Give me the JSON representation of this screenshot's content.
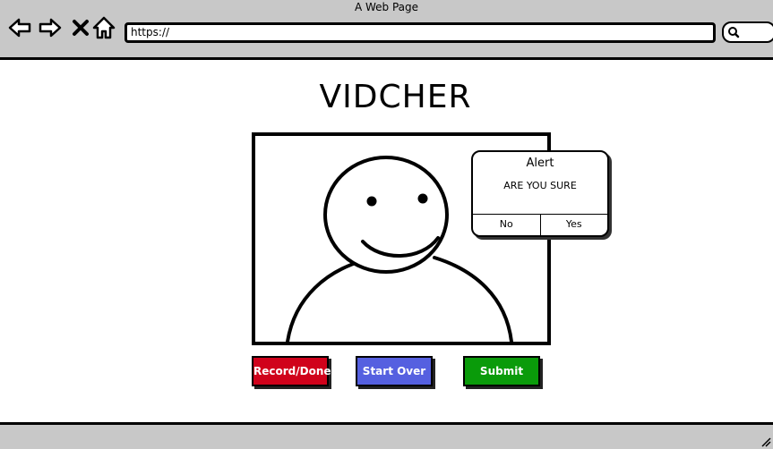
{
  "window": {
    "title": "A Web Page"
  },
  "browser": {
    "url": "https://",
    "icons": [
      "back-arrow-icon",
      "forward-arrow-icon",
      "close-x-icon",
      "home-icon",
      "search-icon"
    ]
  },
  "page": {
    "title": "VIDCHER"
  },
  "video": {
    "content": "person-avatar-icon"
  },
  "alert": {
    "title": "Alert",
    "message": "ARE YOU SURE",
    "no_label": "No",
    "yes_label": "Yes"
  },
  "buttons": {
    "record": {
      "label": "Record/Done",
      "color": "#d0021b"
    },
    "start_over": {
      "label": "Start Over",
      "color": "#5560e0"
    },
    "submit": {
      "label": "Submit",
      "color": "#0a9b0a"
    }
  },
  "colors": {
    "chrome": "#c8c8c8",
    "border": "#000000"
  }
}
